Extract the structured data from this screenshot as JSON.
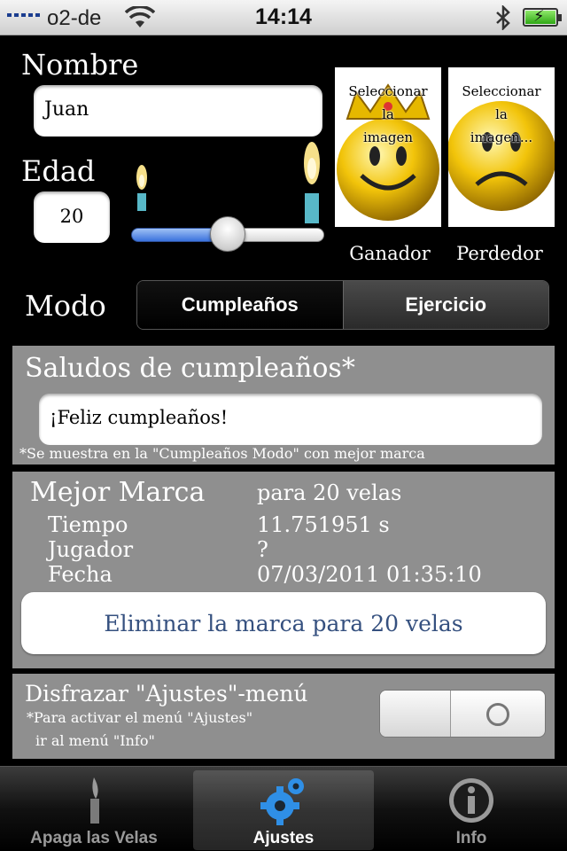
{
  "status_bar": {
    "carrier": "o2-de",
    "time": "14:14"
  },
  "profile": {
    "name_label": "Nombre",
    "name_value": "Juan",
    "age_label": "Edad",
    "age_value": "20",
    "candle_slider_fraction": 0.5
  },
  "images": {
    "winner_caption": "Seleccionar\nla\nimagen",
    "winner_label": "Ganador",
    "loser_caption": "Seleccionar\nla\nimagen...",
    "loser_label": "Perdedor"
  },
  "mode": {
    "label": "Modo",
    "options": [
      "Cumpleaños",
      "Ejercicio"
    ],
    "selected": "Cumpleaños"
  },
  "greeting": {
    "title": "Saludos de cumpleaños*",
    "value": "¡Feliz cumpleaños!",
    "note": "*Se muestra en la \"Cumpleaños  Modo\" con mejor marca"
  },
  "record": {
    "title": "Mejor Marca",
    "candles": "para 20 velas",
    "time_label": "Tiempo",
    "time_value": "11.751951 s",
    "player_label": "Jugador",
    "player_value": "?",
    "date_label": "Fecha",
    "date_value": "07/03/2011 01:35:10",
    "delete_button": "Eliminar la marca para 20 velas"
  },
  "disguise": {
    "title": "Disfrazar \"Ajustes\"-menú",
    "note_line1": "*Para activar el menú \"Ajustes\"",
    "note_line2": "ir al menú \"Info\"",
    "enabled": false
  },
  "tabs": [
    {
      "label": "Apaga las Velas",
      "icon": "candle-icon"
    },
    {
      "label": "Ajustes",
      "icon": "gear-icon"
    },
    {
      "label": "Info",
      "icon": "info-icon"
    }
  ],
  "selected_tab": "Ajustes",
  "colors": {
    "panel": "#8f8f8f",
    "slider_fill": "#3a72dd",
    "delete_text": "#35507f",
    "active_tab_icon": "#2f8fe6"
  }
}
